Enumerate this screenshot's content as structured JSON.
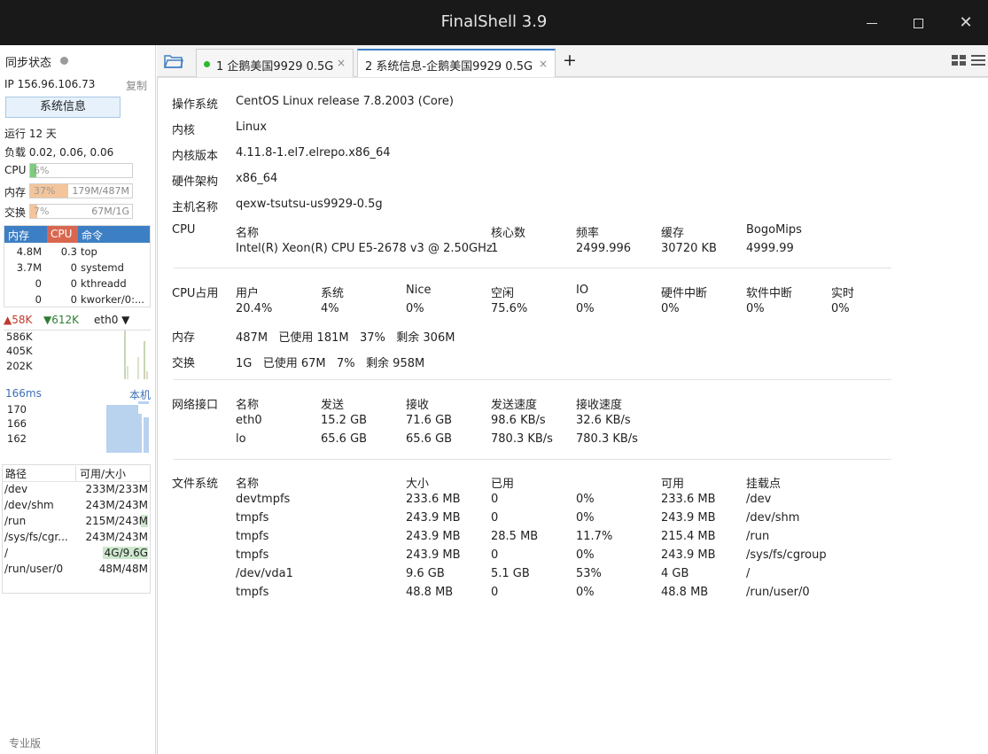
{
  "window": {
    "title": "FinalShell 3.9"
  },
  "sidebar": {
    "sync_label": "同步状态",
    "ip": "IP 156.96.106.73",
    "copy_label": "复制",
    "sysinfo_button": "系统信息",
    "uptime": "运行 12 天",
    "load": "负载 0.02, 0.06, 0.06",
    "meters": [
      {
        "label": "CPU",
        "pct": "6%",
        "value": "",
        "fraction": 0.06,
        "color": "#7ccd7c"
      },
      {
        "label": "内存",
        "pct": "37%",
        "value": "179M/487M",
        "fraction": 0.37,
        "color": "#f4c59a"
      },
      {
        "label": "交换",
        "pct": "7%",
        "value": "67M/1G",
        "fraction": 0.07,
        "color": "#f4c59a"
      }
    ],
    "process_table": {
      "headers": [
        "内存",
        "CPU",
        "命令"
      ],
      "rows": [
        {
          "mem": "4.8M",
          "cpu": "0.3",
          "cmd": "top"
        },
        {
          "mem": "3.7M",
          "cpu": "0",
          "cmd": "systemd"
        },
        {
          "mem": "0",
          "cpu": "0",
          "cmd": "kthreadd"
        },
        {
          "mem": "0",
          "cpu": "0",
          "cmd": "kworker/0:..."
        }
      ]
    },
    "network": {
      "up": "58K",
      "down": "612K",
      "interface": "eth0",
      "ticks": [
        "586K",
        "405K",
        "202K"
      ]
    },
    "ping": {
      "ms": "166ms",
      "host": "本机",
      "ticks": [
        "170",
        "166",
        "162"
      ]
    },
    "fs_table": {
      "headers": [
        "路径",
        "可用/大小"
      ],
      "rows": [
        {
          "path": "/dev",
          "size": "233M/233M"
        },
        {
          "path": "/dev/shm",
          "size": "243M/243M"
        },
        {
          "path": "/run",
          "size": "215M/243M"
        },
        {
          "path": "/sys/fs/cgr...",
          "size": "243M/243M"
        },
        {
          "path": "/",
          "size": "4G/9.6G"
        },
        {
          "path": "/run/user/0",
          "size": "48M/48M"
        }
      ]
    },
    "edition": "专业版"
  },
  "tabs": [
    {
      "label": "1 企鹅美国9929 0.5G",
      "close": "×"
    },
    {
      "label": "2 系统信息-企鹅美国9929 0.5G",
      "close": "×"
    }
  ],
  "add_tab": "+",
  "info": {
    "os_label": "操作系统",
    "os": "CentOS Linux release 7.8.2003 (Core)",
    "kernel_label": "内核",
    "kernel": "Linux",
    "kver_label": "内核版本",
    "kver": "4.11.8-1.el7.elrepo.x86_64",
    "arch_label": "硬件架构",
    "arch": "x86_64",
    "host_label": "主机名称",
    "host": "qexw-tsutsu-us9929-0.5g",
    "cpu_label": "CPU",
    "cpu_headers": [
      "名称",
      "核心数",
      "频率",
      "缓存",
      "BogoMips"
    ],
    "cpu_values": [
      "Intel(R) Xeon(R) CPU E5-2678 v3 @ 2.50GHz",
      "1",
      "2499.996",
      "30720 KB",
      "4999.99"
    ],
    "cpuuse_label": "CPU占用",
    "cpuuse_headers": [
      "用户",
      "系统",
      "Nice",
      "空闲",
      "IO",
      "硬件中断",
      "软件中断",
      "实时"
    ],
    "cpuuse_values": [
      "20.4%",
      "4%",
      "0%",
      "75.6%",
      "0%",
      "0%",
      "0%",
      "0%"
    ],
    "mem_label": "内存",
    "mem": "487M   已使用 181M   37%   剩余 306M",
    "swap_label": "交换",
    "swap": "1G   已使用 67M   7%   剩余 958M",
    "net_label": "网络接口",
    "net_headers": [
      "名称",
      "发送",
      "接收",
      "发送速度",
      "接收速度"
    ],
    "net_rows": [
      [
        "eth0",
        "15.2 GB",
        "71.6 GB",
        "98.6 KB/s",
        "32.6 KB/s"
      ],
      [
        "lo",
        "65.6 GB",
        "65.6 GB",
        "780.3 KB/s",
        "780.3 KB/s"
      ]
    ],
    "fs_label": "文件系统",
    "fs_headers": [
      "名称",
      "大小",
      "已用",
      "",
      "可用",
      "挂载点"
    ],
    "fs_rows": [
      [
        "devtmpfs",
        "233.6 MB",
        "0",
        "0%",
        "233.6 MB",
        "/dev"
      ],
      [
        "tmpfs",
        "243.9 MB",
        "0",
        "0%",
        "243.9 MB",
        "/dev/shm"
      ],
      [
        "tmpfs",
        "243.9 MB",
        "28.5 MB",
        "11.7%",
        "215.4 MB",
        "/run"
      ],
      [
        "tmpfs",
        "243.9 MB",
        "0",
        "0%",
        "243.9 MB",
        "/sys/fs/cgroup"
      ],
      [
        "/dev/vda1",
        "9.6 GB",
        "5.1 GB",
        "53%",
        "4 GB",
        "/"
      ],
      [
        "tmpfs",
        "48.8 MB",
        "0",
        "0%",
        "48.8 MB",
        "/run/user/0"
      ]
    ]
  }
}
